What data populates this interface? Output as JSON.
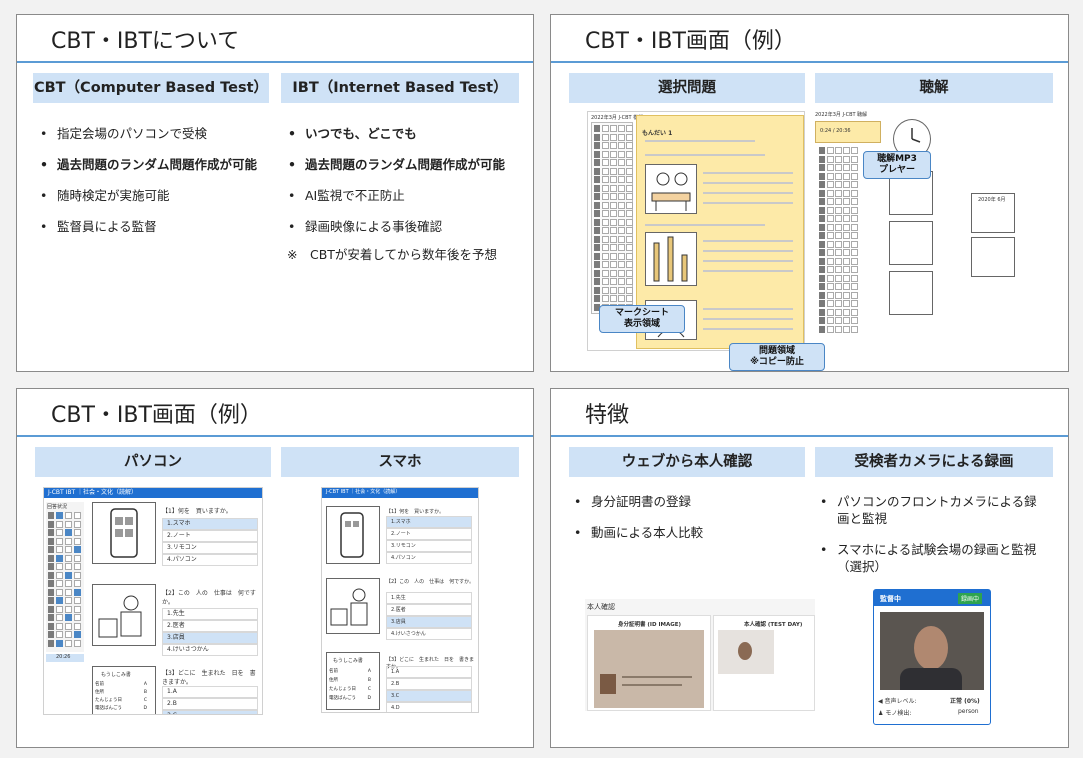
{
  "slide1": {
    "title": "CBT・IBTについて",
    "cbt_header": "CBT（Computer Based Test）",
    "ibt_header": "IBT（Internet Based Test）",
    "cbt_items": [
      {
        "text": "指定会場のパソコンで受検",
        "bold": false
      },
      {
        "text": "過去問題のランダム問題作成が可能",
        "bold": true
      },
      {
        "text": "随時検定が実施可能",
        "bold": false
      },
      {
        "text": "監督員による監督",
        "bold": false
      }
    ],
    "ibt_items": [
      {
        "text": "いつでも、どこでも",
        "bold": true
      },
      {
        "text": "過去問題のランダム問題作成が可能",
        "bold": true
      },
      {
        "text": "AI監視で不正防止",
        "bold": false
      },
      {
        "text": "録画映像による事後確認",
        "bold": false
      }
    ],
    "note": "※　CBTが安着してから数年後を予想"
  },
  "slide2": {
    "title": "CBT・IBT画面（例）",
    "left_header": "選択問題",
    "right_header": "聴解",
    "callout_marksheet": "マークシート\n表示領域",
    "callout_question": "問題領域\n※コピー防止",
    "callout_player": "聴解MP3\nプレヤー",
    "shot_header": "2022年3月 J-CBT 模擬",
    "question_label": "もんだい 1",
    "listening_header": "2022年3月 J-CBT 聴解",
    "player_time": "0:24 / 20:36",
    "calendar_label": "2020年 6月"
  },
  "slide3": {
    "title": "CBT・IBT画面（例）",
    "pc_header": "パソコン",
    "phone_header": "スマホ",
    "pc_bar": "J-CBT IBT ｜社会・文化（読解）",
    "phone_bar": "J-CBT IBT ｜社会・文化（読解）",
    "q1": "【1】何を　買いますか。",
    "q2": "【2】この　人の　仕事は　何ですか。",
    "q3": "【3】どこに　生まれた　日を　書きますか。",
    "q1_options": [
      "1.スマホ",
      "2.ノート",
      "3.リモコン",
      "4.パソコン"
    ],
    "q2_options": [
      "1.先生",
      "2.医者",
      "3.店員",
      "4.けいさつかん"
    ],
    "q3_options": [
      "1.A",
      "2.B",
      "3.C",
      "4.D"
    ],
    "form_title": "もうしこみ書",
    "form_rows": [
      "名前",
      "住所",
      "たんじょう日",
      "電話ばんごう"
    ],
    "form_cells": [
      "A",
      "B",
      "C",
      "D"
    ],
    "pc_panel_label": "回答状況",
    "pc_time": "20:26"
  },
  "slide4": {
    "title": "特徴",
    "left_header": "ウェブから本人確認",
    "right_header": "受検者カメラによる録画",
    "left_items": [
      "身分証明書の登録",
      "動画による本人比較"
    ],
    "right_items": [
      "パソコンのフロントカメラによる録画と監視",
      "スマホによる試験会場の録画と監視（選択）"
    ],
    "id_panel_title": "本人確認",
    "id_image_label": "身分証明書 (ID IMAGE)",
    "test_day_label": "本人確認 (TEST DAY)",
    "monitor_title": "監督中",
    "monitor_badge": "録画中",
    "sound_label": "音声レベル:",
    "sound_value": "正常 (0%)",
    "object_label": "モノ検出:",
    "object_value": "person"
  },
  "colors": {
    "accent": "#5b9bd5",
    "header_bg": "#cfe2f6",
    "highlight": "#fdeaa8",
    "blue": "#1f6fd1",
    "green": "#2ea44f"
  }
}
